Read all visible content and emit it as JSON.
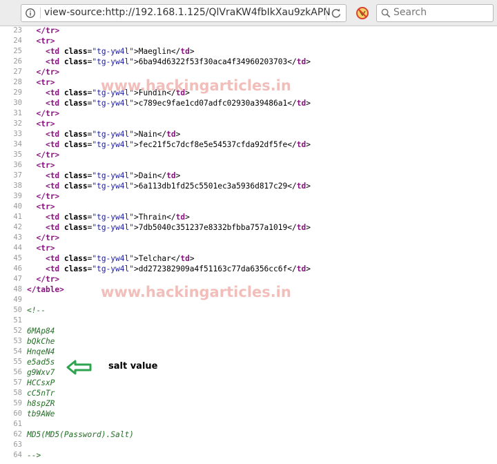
{
  "toolbar": {
    "url": "view-source:http://192.168.1.125/QlVraKW4fbIkXau9zkAPN",
    "search_placeholder": "Search",
    "info_icon": "info-icon",
    "reload_icon": "reload-icon",
    "addon_icon": "no-script-icon",
    "search_icon": "search-icon"
  },
  "source_lines": [
    {
      "num": "23",
      "segs": [
        [
          "t",
          "  "
        ],
        [
          "g",
          "</"
        ],
        [
          "g",
          "tr"
        ],
        [
          "g",
          ">"
        ]
      ]
    },
    {
      "num": "24",
      "segs": [
        [
          "t",
          "  "
        ],
        [
          "g",
          "<"
        ],
        [
          "g",
          "tr"
        ],
        [
          "g",
          ">"
        ]
      ]
    },
    {
      "num": "25",
      "segs": [
        [
          "t",
          "    "
        ],
        [
          "g",
          "<td "
        ],
        [
          "a",
          "class"
        ],
        [
          "t",
          "="
        ],
        [
          "v",
          "\"tg-yw4l\""
        ],
        [
          "t",
          ">Maeglin</"
        ],
        [
          "g",
          "td"
        ],
        [
          "t",
          ">"
        ]
      ]
    },
    {
      "num": "26",
      "segs": [
        [
          "t",
          "    "
        ],
        [
          "g",
          "<td "
        ],
        [
          "a",
          "class"
        ],
        [
          "t",
          "="
        ],
        [
          "v",
          "\"tg-yw4l\""
        ],
        [
          "t",
          ">6ba94d6322f53f30aca4f34960203703</"
        ],
        [
          "g",
          "td"
        ],
        [
          "t",
          ">"
        ]
      ]
    },
    {
      "num": "27",
      "segs": [
        [
          "t",
          "  "
        ],
        [
          "g",
          "</tr>"
        ]
      ]
    },
    {
      "num": "28",
      "segs": [
        [
          "t",
          "  "
        ],
        [
          "g",
          "<tr>"
        ]
      ]
    },
    {
      "num": "29",
      "segs": [
        [
          "t",
          "    "
        ],
        [
          "g",
          "<td "
        ],
        [
          "a",
          "class"
        ],
        [
          "t",
          "="
        ],
        [
          "v",
          "\"tg-yw4l\""
        ],
        [
          "t",
          ">Fundin</"
        ],
        [
          "g",
          "td"
        ],
        [
          "t",
          ">"
        ]
      ]
    },
    {
      "num": "30",
      "segs": [
        [
          "t",
          "    "
        ],
        [
          "g",
          "<td "
        ],
        [
          "a",
          "class"
        ],
        [
          "t",
          "="
        ],
        [
          "v",
          "\"tg-yw4l\""
        ],
        [
          "t",
          ">c789ec9fae1cd07adfc02930a39486a1</"
        ],
        [
          "g",
          "td"
        ],
        [
          "t",
          ">"
        ]
      ]
    },
    {
      "num": "31",
      "segs": [
        [
          "t",
          "  "
        ],
        [
          "g",
          "</tr>"
        ]
      ]
    },
    {
      "num": "32",
      "segs": [
        [
          "t",
          "  "
        ],
        [
          "g",
          "<tr>"
        ]
      ]
    },
    {
      "num": "33",
      "segs": [
        [
          "t",
          "    "
        ],
        [
          "g",
          "<td "
        ],
        [
          "a",
          "class"
        ],
        [
          "t",
          "="
        ],
        [
          "v",
          "\"tg-yw4l\""
        ],
        [
          "t",
          ">Nain</"
        ],
        [
          "g",
          "td"
        ],
        [
          "t",
          ">"
        ]
      ]
    },
    {
      "num": "34",
      "segs": [
        [
          "t",
          "    "
        ],
        [
          "g",
          "<td "
        ],
        [
          "a",
          "class"
        ],
        [
          "t",
          "="
        ],
        [
          "v",
          "\"tg-yw4l\""
        ],
        [
          "t",
          ">fec21f5c7dcf8e5e54537cfda92df5fe</"
        ],
        [
          "g",
          "td"
        ],
        [
          "t",
          ">"
        ]
      ]
    },
    {
      "num": "35",
      "segs": [
        [
          "t",
          "  "
        ],
        [
          "g",
          "</tr>"
        ]
      ]
    },
    {
      "num": "36",
      "segs": [
        [
          "t",
          "  "
        ],
        [
          "g",
          "<tr>"
        ]
      ]
    },
    {
      "num": "37",
      "segs": [
        [
          "t",
          "    "
        ],
        [
          "g",
          "<td "
        ],
        [
          "a",
          "class"
        ],
        [
          "t",
          "="
        ],
        [
          "v",
          "\"tg-yw4l\""
        ],
        [
          "t",
          ">Dain</"
        ],
        [
          "g",
          "td"
        ],
        [
          "t",
          ">"
        ]
      ]
    },
    {
      "num": "38",
      "segs": [
        [
          "t",
          "    "
        ],
        [
          "g",
          "<td "
        ],
        [
          "a",
          "class"
        ],
        [
          "t",
          "="
        ],
        [
          "v",
          "\"tg-yw4l\""
        ],
        [
          "t",
          ">6a113db1fd25c5501ec3a5936d817c29</"
        ],
        [
          "g",
          "td"
        ],
        [
          "t",
          ">"
        ]
      ]
    },
    {
      "num": "39",
      "segs": [
        [
          "t",
          "  "
        ],
        [
          "g",
          "</tr>"
        ]
      ]
    },
    {
      "num": "40",
      "segs": [
        [
          "t",
          "  "
        ],
        [
          "g",
          "<tr>"
        ]
      ]
    },
    {
      "num": "41",
      "segs": [
        [
          "t",
          "    "
        ],
        [
          "g",
          "<td "
        ],
        [
          "a",
          "class"
        ],
        [
          "t",
          "="
        ],
        [
          "v",
          "\"tg-yw4l\""
        ],
        [
          "t",
          ">Thrain</"
        ],
        [
          "g",
          "td"
        ],
        [
          "t",
          ">"
        ]
      ]
    },
    {
      "num": "42",
      "segs": [
        [
          "t",
          "    "
        ],
        [
          "g",
          "<td "
        ],
        [
          "a",
          "class"
        ],
        [
          "t",
          "="
        ],
        [
          "v",
          "\"tg-yw4l\""
        ],
        [
          "t",
          ">7db5040c351237e8332bfbba757a1019</"
        ],
        [
          "g",
          "td"
        ],
        [
          "t",
          ">"
        ]
      ]
    },
    {
      "num": "43",
      "segs": [
        [
          "t",
          "  "
        ],
        [
          "g",
          "</tr>"
        ]
      ]
    },
    {
      "num": "44",
      "segs": [
        [
          "t",
          "  "
        ],
        [
          "g",
          "<tr>"
        ]
      ]
    },
    {
      "num": "45",
      "segs": [
        [
          "t",
          "    "
        ],
        [
          "g",
          "<td "
        ],
        [
          "a",
          "class"
        ],
        [
          "t",
          "="
        ],
        [
          "v",
          "\"tg-yw4l\""
        ],
        [
          "t",
          ">Telchar</"
        ],
        [
          "g",
          "td"
        ],
        [
          "t",
          ">"
        ]
      ]
    },
    {
      "num": "46",
      "segs": [
        [
          "t",
          "    "
        ],
        [
          "g",
          "<td "
        ],
        [
          "a",
          "class"
        ],
        [
          "t",
          "="
        ],
        [
          "v",
          "\"tg-yw4l\""
        ],
        [
          "t",
          ">dd272382909a4f51163c77da6356cc6f</"
        ],
        [
          "g",
          "td"
        ],
        [
          "t",
          ">"
        ]
      ]
    },
    {
      "num": "47",
      "segs": [
        [
          "t",
          "  "
        ],
        [
          "g",
          "</tr>"
        ]
      ]
    },
    {
      "num": "48",
      "segs": [
        [
          "g",
          "</table>"
        ]
      ]
    },
    {
      "num": "49",
      "segs": []
    },
    {
      "num": "50",
      "segs": [
        [
          "c",
          "<!--"
        ]
      ]
    },
    {
      "num": "51",
      "segs": []
    },
    {
      "num": "52",
      "segs": [
        [
          "c",
          "6MAp84"
        ]
      ]
    },
    {
      "num": "53",
      "segs": [
        [
          "c",
          "bQkChe"
        ]
      ]
    },
    {
      "num": "54",
      "segs": [
        [
          "c",
          "HnqeN4"
        ]
      ]
    },
    {
      "num": "55",
      "segs": [
        [
          "c",
          "e5ad5s"
        ]
      ]
    },
    {
      "num": "56",
      "segs": [
        [
          "c",
          "g9Wxv7"
        ]
      ]
    },
    {
      "num": "57",
      "segs": [
        [
          "c",
          "HCCsxP"
        ]
      ]
    },
    {
      "num": "58",
      "segs": [
        [
          "c",
          "cC5nTr"
        ]
      ]
    },
    {
      "num": "59",
      "segs": [
        [
          "c",
          "h8spZR"
        ]
      ]
    },
    {
      "num": "60",
      "segs": [
        [
          "c",
          "tb9AWe"
        ]
      ]
    },
    {
      "num": "61",
      "segs": []
    },
    {
      "num": "62",
      "segs": [
        [
          "c",
          "MD5(MD5(Password).Salt)"
        ]
      ]
    },
    {
      "num": "63",
      "segs": []
    },
    {
      "num": "64",
      "segs": [
        [
          "c",
          "-->"
        ]
      ]
    }
  ],
  "watermark": "www.hackingarticles.in",
  "annotation": {
    "label": "salt value",
    "arrow_color": "#2ea44f"
  }
}
